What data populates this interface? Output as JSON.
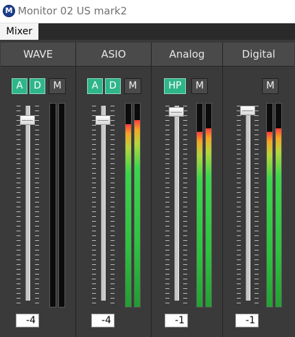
{
  "window": {
    "title": "Monitor 02 US mark2",
    "icon": "M"
  },
  "menu": {
    "mixer": "Mixer"
  },
  "channels": [
    {
      "name": "WAVE",
      "buttons": {
        "a": "A",
        "d": "D",
        "m": "M"
      },
      "fader_value": "-4",
      "meter_levels": [
        0,
        0
      ]
    },
    {
      "name": "ASIO",
      "buttons": {
        "a": "A",
        "d": "D",
        "m": "M"
      },
      "fader_value": "-4",
      "meter_levels": [
        0.9,
        0.92
      ]
    },
    {
      "name": "Analog",
      "buttons": {
        "hp": "HP",
        "m": "M"
      },
      "fader_value": "-1",
      "meter_levels": [
        0.86,
        0.88
      ]
    },
    {
      "name": "Digital",
      "buttons": {
        "m": "M"
      },
      "fader_value": "-1",
      "meter_levels": [
        0.86,
        0.88
      ]
    }
  ],
  "colors": {
    "button_active": "#2fb58a",
    "meter_peak": "#ff3b3b",
    "meter_signal": "#3bd64b"
  }
}
